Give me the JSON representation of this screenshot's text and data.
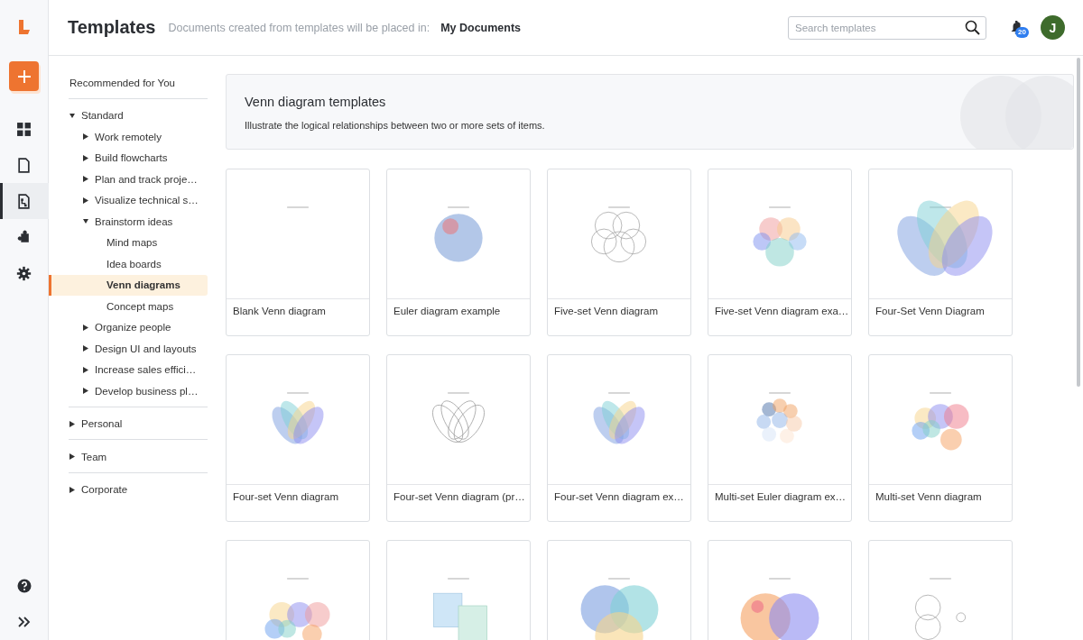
{
  "rail": [
    {
      "kind": "dashboard",
      "selected": false
    },
    {
      "kind": "documents",
      "selected": false
    },
    {
      "kind": "templates",
      "selected": true
    },
    {
      "kind": "integrations",
      "selected": false
    },
    {
      "kind": "settings",
      "selected": false
    }
  ],
  "header": {
    "title": "Templates",
    "subtitle": "Documents created from templates will be placed in:",
    "folder": "My Documents",
    "search": {
      "placeholder": "Search templates"
    },
    "notifications": "20",
    "avatar": "J"
  },
  "sidebar": {
    "top": {
      "label": "Recommended for You",
      "selected": false
    },
    "groups": [
      {
        "label": "Standard",
        "expanded": true,
        "selected": false,
        "children": [
          {
            "label": "Work remotely",
            "expanded": false,
            "selected": false
          },
          {
            "label": "Build flowcharts",
            "expanded": false,
            "selected": false
          },
          {
            "label": "Plan and track proje…",
            "expanded": false,
            "selected": false
          },
          {
            "label": "Visualize technical s…",
            "expanded": false,
            "selected": false
          },
          {
            "label": "Brainstorm ideas",
            "expanded": true,
            "selected": false,
            "children": [
              {
                "label": "Mind maps",
                "selected": false
              },
              {
                "label": "Idea boards",
                "selected": false
              },
              {
                "label": "Venn diagrams",
                "selected": true
              },
              {
                "label": "Concept maps",
                "selected": false
              }
            ]
          },
          {
            "label": "Organize people",
            "expanded": false,
            "selected": false
          },
          {
            "label": "Design UI and layouts",
            "expanded": false,
            "selected": false
          },
          {
            "label": "Increase sales effici…",
            "expanded": false,
            "selected": false
          },
          {
            "label": "Develop business pl…",
            "expanded": false,
            "selected": false
          }
        ]
      },
      {
        "label": "Personal",
        "expanded": false,
        "selected": false
      },
      {
        "label": "Team",
        "expanded": false,
        "selected": false
      },
      {
        "label": "Corporate",
        "expanded": false,
        "selected": false
      }
    ]
  },
  "banner": {
    "title": "Venn diagram templates",
    "description": "Illustrate the logical relationships between two or more sets of items."
  },
  "templates": [
    {
      "title": "Blank Venn diagram",
      "kind": "blank"
    },
    {
      "title": "Euler diagram example",
      "kind": "euler"
    },
    {
      "title": "Five-set Venn diagram",
      "kind": "five-outline"
    },
    {
      "title": "Five-set Venn diagram exa…",
      "kind": "five-color"
    },
    {
      "title": "Four-Set Venn Diagram",
      "kind": "four-large"
    },
    {
      "title": "Four-set Venn diagram",
      "kind": "four-color"
    },
    {
      "title": "Four-set Venn diagram (pr…",
      "kind": "four-outline"
    },
    {
      "title": "Four-set Venn diagram ex…",
      "kind": "four-color"
    },
    {
      "title": "Multi-set Euler diagram ex…",
      "kind": "multi-euler"
    },
    {
      "title": "Multi-set Venn diagram",
      "kind": "multi-set"
    },
    {
      "kind": "multi-labeled"
    },
    {
      "kind": "notes"
    },
    {
      "kind": "three-set"
    },
    {
      "kind": "two-set"
    },
    {
      "kind": "outline-small"
    }
  ]
}
